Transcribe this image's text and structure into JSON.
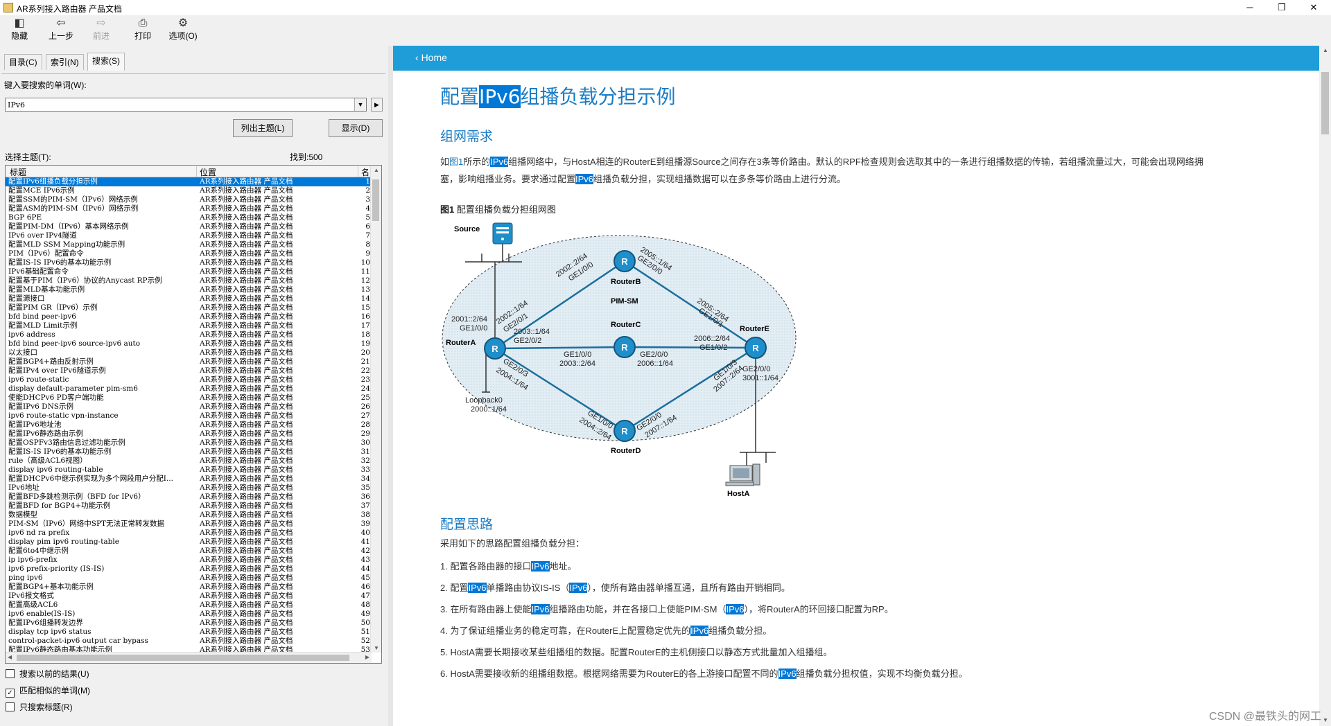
{
  "window": {
    "title": "AR系列接入路由器 产品文档",
    "minimize": "─",
    "restore": "❐",
    "close": "✕"
  },
  "toolbar": {
    "hide": "隐藏",
    "back": "上一步",
    "forward": "前进",
    "print": "打印",
    "options": "选项(O)"
  },
  "left": {
    "tabs": [
      "目录(C)",
      "索引(N)",
      "搜索(S)"
    ],
    "search_label": "键入要搜索的单词(W):",
    "search_value": "IPv6",
    "list_topics_btn": "列出主题(L)",
    "display_btn": "显示(D)",
    "select_topic_label": "选择主题(T):",
    "found": "找到:500",
    "columns": [
      "标题",
      "位置",
      "名"
    ],
    "rows": [
      [
        "配置IPv6组播负载分担示例",
        "AR系列接入路由器 产品文档",
        "1"
      ],
      [
        "配置MCE IPv6示例",
        "AR系列接入路由器 产品文档",
        "2"
      ],
      [
        "配置SSM的PIM-SM（IPv6）网络示例",
        "AR系列接入路由器 产品文档",
        "3"
      ],
      [
        "配置ASM的PIM-SM（IPv6）网络示例",
        "AR系列接入路由器 产品文档",
        "4"
      ],
      [
        "BGP 6PE",
        "AR系列接入路由器 产品文档",
        "5"
      ],
      [
        "配置PIM-DM（IPv6）基本网络示例",
        "AR系列接入路由器 产品文档",
        "6"
      ],
      [
        "IPv6 over IPv4隧道",
        "AR系列接入路由器 产品文档",
        "7"
      ],
      [
        "配置MLD SSM Mapping功能示例",
        "AR系列接入路由器 产品文档",
        "8"
      ],
      [
        "PIM（IPv6）配置命令",
        "AR系列接入路由器 产品文档",
        "9"
      ],
      [
        "配置IS-IS IPv6的基本功能示例",
        "AR系列接入路由器 产品文档",
        "10"
      ],
      [
        "IPv6基础配置命令",
        "AR系列接入路由器 产品文档",
        "11"
      ],
      [
        "配置基于PIM（IPv6）协议的Anycast RP示例",
        "AR系列接入路由器 产品文档",
        "12"
      ],
      [
        "配置MLD基本功能示例",
        "AR系列接入路由器 产品文档",
        "13"
      ],
      [
        "配置源接口",
        "AR系列接入路由器 产品文档",
        "14"
      ],
      [
        "配置PIM GR（IPv6）示例",
        "AR系列接入路由器 产品文档",
        "15"
      ],
      [
        "bfd bind peer-ipv6",
        "AR系列接入路由器 产品文档",
        "16"
      ],
      [
        "配置MLD Limit示例",
        "AR系列接入路由器 产品文档",
        "17"
      ],
      [
        "ipv6 address",
        "AR系列接入路由器 产品文档",
        "18"
      ],
      [
        "bfd bind peer-ipv6 source-ipv6 auto",
        "AR系列接入路由器 产品文档",
        "19"
      ],
      [
        "以太接口",
        "AR系列接入路由器 产品文档",
        "20"
      ],
      [
        "配置BGP4+路由反射示例",
        "AR系列接入路由器 产品文档",
        "21"
      ],
      [
        "配置IPv4 over IPv6隧道示例",
        "AR系列接入路由器 产品文档",
        "22"
      ],
      [
        "ipv6 route-static",
        "AR系列接入路由器 产品文档",
        "23"
      ],
      [
        "display default-parameter pim-sm6",
        "AR系列接入路由器 产品文档",
        "24"
      ],
      [
        "使能DHCPv6 PD客户端功能",
        "AR系列接入路由器 产品文档",
        "25"
      ],
      [
        "配置IPv6 DNS示例",
        "AR系列接入路由器 产品文档",
        "26"
      ],
      [
        "ipv6 route-static vpn-instance",
        "AR系列接入路由器 产品文档",
        "27"
      ],
      [
        "配置IPv6地址池",
        "AR系列接入路由器 产品文档",
        "28"
      ],
      [
        "配置IPv6静态路由示例",
        "AR系列接入路由器 产品文档",
        "29"
      ],
      [
        "配置OSPFv3路由信息过滤功能示例",
        "AR系列接入路由器 产品文档",
        "30"
      ],
      [
        "配置IS-IS IPv6的基本功能示例",
        "AR系列接入路由器 产品文档",
        "31"
      ],
      [
        "rule（高级ACL6视图）",
        "AR系列接入路由器 产品文档",
        "32"
      ],
      [
        "display ipv6 routing-table",
        "AR系列接入路由器 产品文档",
        "33"
      ],
      [
        "配置DHCPv6中继示例实现为多个网段用户分配I...",
        "AR系列接入路由器 产品文档",
        "34"
      ],
      [
        "IPv6地址",
        "AR系列接入路由器 产品文档",
        "35"
      ],
      [
        "配置BFD多跳检测示例（BFD for IPv6）",
        "AR系列接入路由器 产品文档",
        "36"
      ],
      [
        "配置BFD for BGP4+功能示例",
        "AR系列接入路由器 产品文档",
        "37"
      ],
      [
        "数据模型",
        "AR系列接入路由器 产品文档",
        "38"
      ],
      [
        "PIM-SM（IPv6）网络中SPT无法正常转发数据",
        "AR系列接入路由器 产品文档",
        "39"
      ],
      [
        "ipv6 nd ra prefix",
        "AR系列接入路由器 产品文档",
        "40"
      ],
      [
        "display pim ipv6 routing-table",
        "AR系列接入路由器 产品文档",
        "41"
      ],
      [
        "配置6to4中继示例",
        "AR系列接入路由器 产品文档",
        "42"
      ],
      [
        "ip ipv6-prefix",
        "AR系列接入路由器 产品文档",
        "43"
      ],
      [
        "ipv6 prefix-priority (IS-IS)",
        "AR系列接入路由器 产品文档",
        "44"
      ],
      [
        "ping ipv6",
        "AR系列接入路由器 产品文档",
        "45"
      ],
      [
        "配置BGP4+基本功能示例",
        "AR系列接入路由器 产品文档",
        "46"
      ],
      [
        "IPv6报文格式",
        "AR系列接入路由器 产品文档",
        "47"
      ],
      [
        "配置高级ACL6",
        "AR系列接入路由器 产品文档",
        "48"
      ],
      [
        "ipv6 enable(IS-IS)",
        "AR系列接入路由器 产品文档",
        "49"
      ],
      [
        "配置IPv6组播转发边界",
        "AR系列接入路由器 产品文档",
        "50"
      ],
      [
        "display tcp ipv6 status",
        "AR系列接入路由器 产品文档",
        "51"
      ],
      [
        "control-packet-ipv6 output car bypass",
        "AR系列接入路由器 产品文档",
        "52"
      ],
      [
        "配置IPv6静态路由基本功能示例",
        "AR系列接入路由器 产品文档",
        "53"
      ]
    ],
    "checkboxes": [
      {
        "label": "搜索以前的结果(U)",
        "checked": false
      },
      {
        "label": "匹配相似的单词(M)",
        "checked": true
      },
      {
        "label": "只搜索标题(R)",
        "checked": false
      }
    ]
  },
  "right": {
    "home": "Home",
    "title_pre": "配置",
    "title_hl": "IPv6",
    "title_post": "组播负载分担示例",
    "sec1": "组网需求",
    "p1": {
      "a": "如",
      "link": "图1",
      "b": "所示的",
      "hl1": "IPv6",
      "c": "组播网络中，与HostA相连的RouterE到组播源Source之间存在3条等价路由。默认的RPF检查规则会选取其中的一条进行组播数据的传输，若组播流量过大，可能会出现网络拥",
      "d": "塞，影响组播业务。要求通过配置",
      "hl2": "IPv6",
      "e": "组播负载分担，实现组播数据可以在多条等价路由上进行分流。"
    },
    "fig_num": "图1",
    "fig_cap": "配置组播负载分担组网图",
    "diagram": {
      "source": "Source",
      "routerA": "RouterA",
      "routerB": "RouterB",
      "routerC": "RouterC",
      "routerD": "RouterD",
      "routerE": "RouterE",
      "hostA": "HostA",
      "pim": "PIM-SM",
      "loopback": "Loopback0",
      "loopback_ip": "2000::1/64",
      "a_ge100_ip": "2001::2/64",
      "a_ge100": "GE1/0/0",
      "a_ge201_ip": "2002::1/64",
      "a_ge201": "GE2/0/1",
      "a_ge202_ip": "2003::1/64",
      "a_ge202": "GE2/0/2",
      "a_ge203": "GE2/0/3",
      "a_ge203_ip": "2004::1/64",
      "b_ge100_ip": "2002::2/64",
      "b_ge100": "GE1/0/0",
      "b_ge200_ip": "2005::1/64",
      "b_ge200": "GE2/0/0",
      "c_ge100": "GE1/0/0",
      "c_ge100_ip": "2003::2/64",
      "c_ge200": "GE2/0/0",
      "c_ge200_ip": "2006::1/64",
      "e_ge101_ip": "2005::2/64",
      "e_ge101": "GE1/0/1",
      "e_ge102_ip": "2006::2/64",
      "e_ge102": "GE1/0/2",
      "e_ge103": "GE1/0/3",
      "e_ge103_ip": "2007::2/64",
      "e_ge200": "GE2/0/0",
      "e_ge200_ip": "3001::1/64",
      "d_ge100": "GE1/0/0",
      "d_ge100_ip": "2004::2/64",
      "d_ge200": "GE2/0/0",
      "d_ge200_ip": "2007::1/64"
    },
    "sec2": "配置思路",
    "p2": "采用如下的思路配置组播负载分担：",
    "steps": [
      {
        "n": "1.",
        "a": "配置各路由器的接口",
        "hl": "IPv6",
        "b": "地址。",
        "hl2": "",
        "c": ""
      },
      {
        "n": "2.",
        "a": "配置",
        "hl": "IPv6",
        "b": "单播路由协议IS-IS（",
        "hl2": "IPv6",
        "c": "），使所有路由器单播互通，且所有路由开销相同。"
      },
      {
        "n": "3.",
        "a": "在所有路由器上使能",
        "hl": "IPv6",
        "b": "组播路由功能，并在各接口上使能PIM-SM（",
        "hl2": "IPv6",
        "c": "），将RouterA的环回接口配置为RP。"
      },
      {
        "n": "4.",
        "a": "为了保证组播业务的稳定可靠，在RouterE上配置稳定优先的",
        "hl": "IPv6",
        "b": "组播负载分担。",
        "hl2": "",
        "c": ""
      },
      {
        "n": "5.",
        "a": "HostA需要长期接收某些组播组的数据。配置RouterE的主机侧接口以静态方式批量加入组播组。",
        "hl": "",
        "b": "",
        "hl2": "",
        "c": ""
      },
      {
        "n": "6.",
        "a": "HostA需要接收新的组播组数据。根据网络需要为RouterE的各上游接口配置不同的",
        "hl": "IPv6",
        "b": "组播负载分担权值，实现不均衡负载分担。",
        "hl2": "",
        "c": ""
      }
    ],
    "watermark": "CSDN @最铁头的网工"
  }
}
